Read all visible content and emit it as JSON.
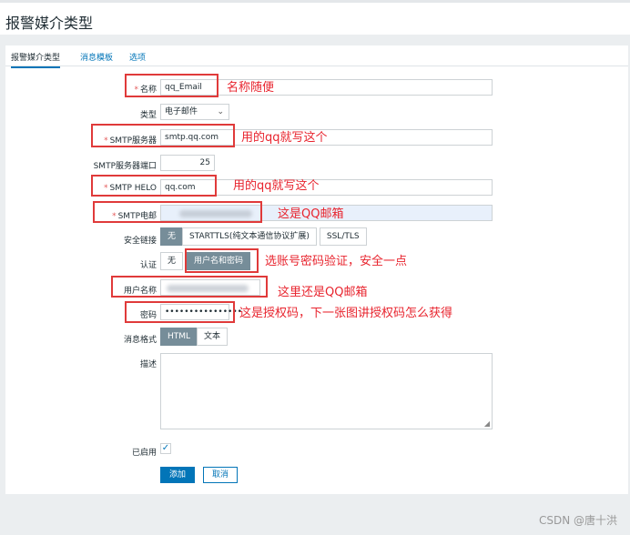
{
  "page": {
    "title": "报警媒介类型"
  },
  "tabs": [
    {
      "label": "报警媒介类型"
    },
    {
      "label": "消息模板"
    },
    {
      "label": "选项"
    }
  ],
  "form": {
    "name": {
      "label": "名称",
      "value": "qq_Email"
    },
    "type": {
      "label": "类型",
      "value": "电子邮件"
    },
    "smtp_server": {
      "label": "SMTP服务器",
      "value": "smtp.qq.com"
    },
    "smtp_port": {
      "label": "SMTP服务器端口",
      "value": "25"
    },
    "smtp_helo": {
      "label": "SMTP HELO",
      "value": "qq.com"
    },
    "smtp_email": {
      "label": "SMTP电邮"
    },
    "security": {
      "label": "安全链接",
      "options": [
        "无",
        "STARTTLS(纯文本通信协议扩展)",
        "SSL/TLS"
      ]
    },
    "auth": {
      "label": "认证",
      "options": [
        "无",
        "用户名和密码"
      ]
    },
    "username": {
      "label": "用户名称"
    },
    "password": {
      "label": "密码",
      "value": "••••••••••••••••"
    },
    "message_format": {
      "label": "消息格式",
      "options": [
        "HTML",
        "文本"
      ]
    },
    "description": {
      "label": "描述"
    },
    "enabled": {
      "label": "已启用",
      "mark": "✓"
    },
    "required_mark": "*"
  },
  "buttons": {
    "add": "添加",
    "cancel": "取消"
  },
  "annotations": {
    "name": "名称随便",
    "smtp_server": "用的qq就写这个",
    "smtp_helo": "用的qq就写这个",
    "smtp_email": "这是QQ邮箱",
    "auth": "选账号密码验证，安全一点",
    "username": "这里还是QQ邮箱",
    "password": "这是授权码，下一张图讲授权码怎么获得"
  },
  "watermark": "CSDN @唐十洪",
  "colors": {
    "annotation_red": "#e03a3a",
    "link_blue": "#0275b8",
    "segment_on": "#768d99"
  }
}
